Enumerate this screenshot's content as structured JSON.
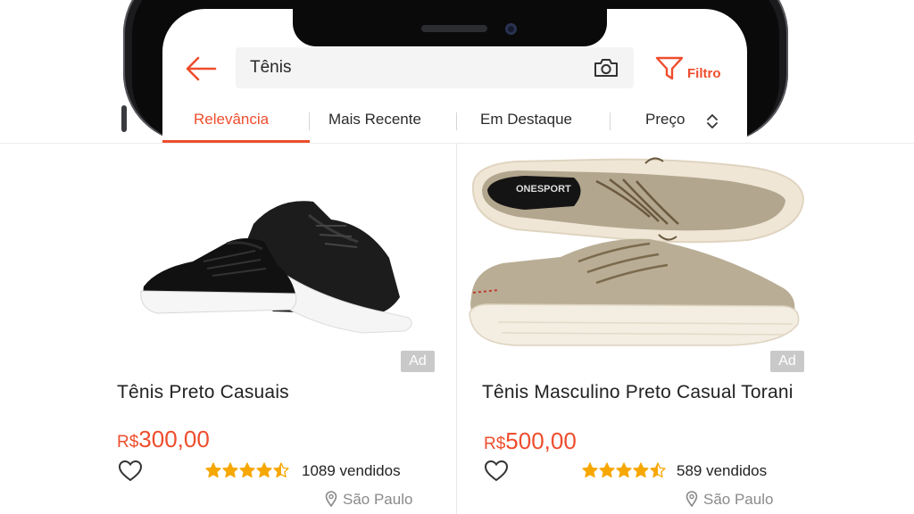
{
  "header": {
    "search_query": "Tênis",
    "filter_label": "Filtro"
  },
  "tabs": [
    {
      "label": "Relevância",
      "active": true
    },
    {
      "label": "Mais Recente",
      "active": false
    },
    {
      "label": "Em Destaque",
      "active": false
    },
    {
      "label": "Preço",
      "active": false
    }
  ],
  "products": [
    {
      "ad_label": "Ad",
      "title": "Tênis Preto Casuais",
      "currency": "R$",
      "price": "300,00",
      "rating": 4.5,
      "sold": "1089 vendidos",
      "location": "São Paulo"
    },
    {
      "ad_label": "Ad",
      "title": "Tênis Masculino Preto Casual Torani",
      "currency": "R$",
      "price": "500,00",
      "rating": 4.5,
      "sold": "589 vendidos",
      "location": "São Paulo"
    }
  ],
  "colors": {
    "accent": "#ee4d2d",
    "star": "#f6a700"
  },
  "icons": [
    "arrow-left-icon",
    "camera-icon",
    "filter-funnel-icon",
    "sort-chevrons-icon",
    "heart-icon",
    "star-icon",
    "location-pin-icon"
  ]
}
